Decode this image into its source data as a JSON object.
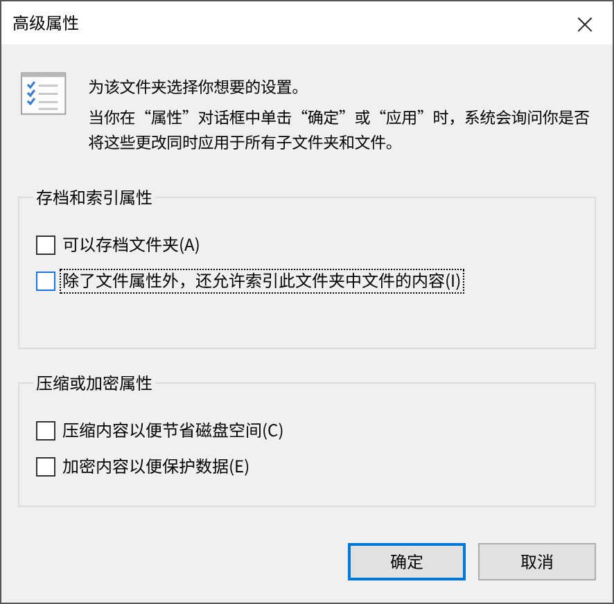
{
  "window": {
    "title": "高级属性",
    "close": "×"
  },
  "intro": [
    "为该文件夹选择你想要的设置。",
    "当你在“属性”对话框中单击“确定”或“应用”时，系统会询问你是否将这些更改同时应用于所有子文件夹和文件。"
  ],
  "groups": [
    {
      "title": "存档和索引属性",
      "options": [
        {
          "label": "可以存档文件夹(A)",
          "checked": false,
          "focused": false
        },
        {
          "label": "除了文件属性外，还允许索引此文件夹中文件的内容(I)",
          "checked": false,
          "focused": true
        }
      ]
    },
    {
      "title": "压缩或加密属性",
      "options": [
        {
          "label": "压缩内容以便节省磁盘空间(C)",
          "checked": false,
          "focused": false
        },
        {
          "label": "加密内容以便保护数据(E)",
          "checked": false,
          "focused": false
        }
      ]
    }
  ],
  "buttons": [
    {
      "label": "确定",
      "default": true
    },
    {
      "label": "取消",
      "default": false
    }
  ]
}
